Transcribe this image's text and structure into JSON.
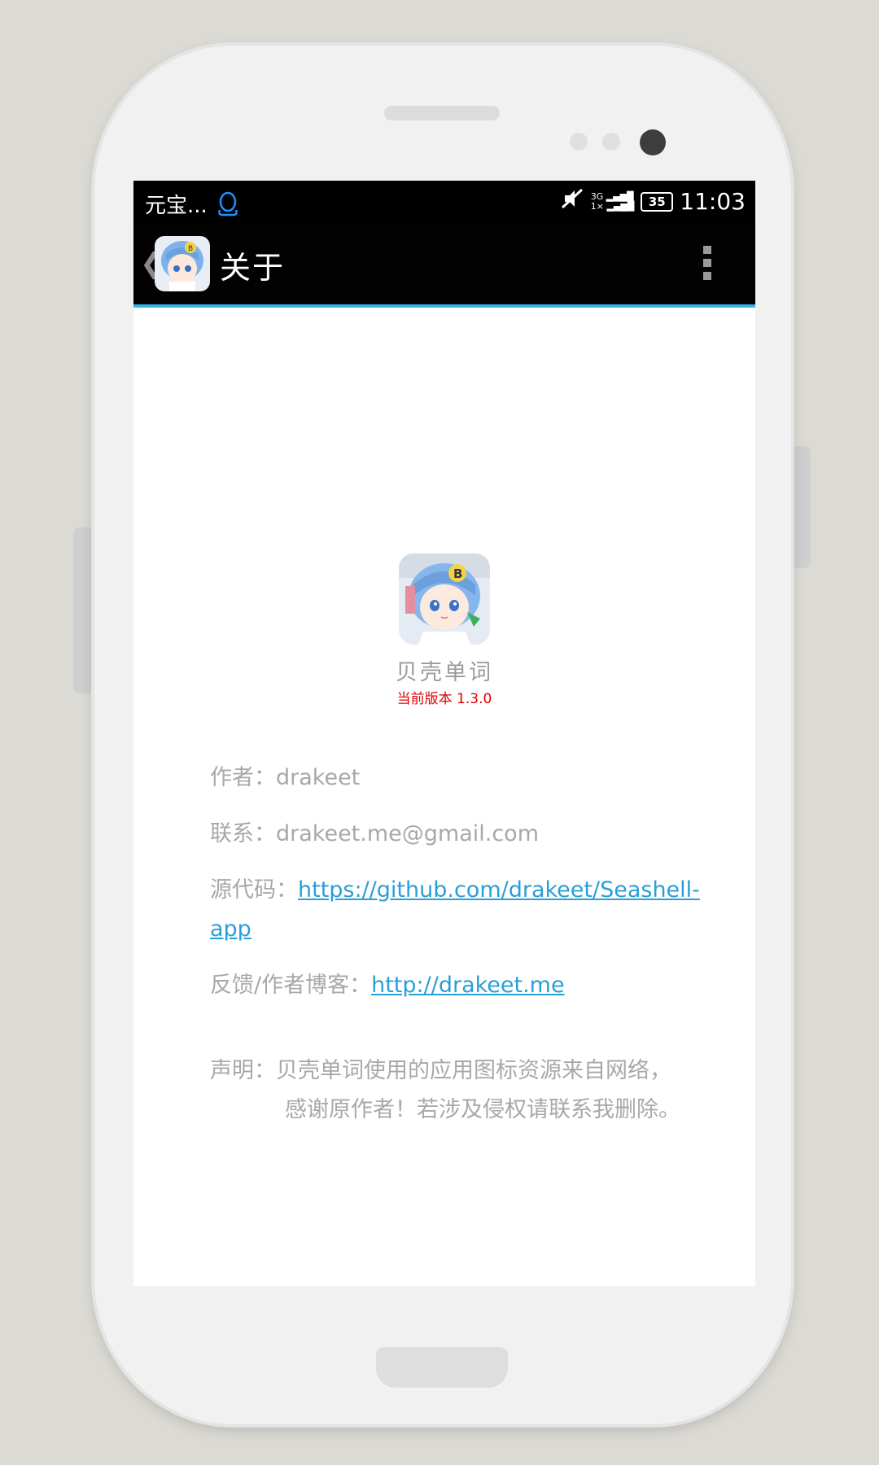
{
  "status_bar": {
    "carrier": "元宝...",
    "network_top": "3G",
    "network_bottom": "1×",
    "battery": "35",
    "time": "11:03"
  },
  "action_bar": {
    "title": "关于"
  },
  "about": {
    "app_name": "贝壳单词",
    "version": "当前版本 1.3.0",
    "author_label": "作者：",
    "author_value": "drakeet",
    "contact_label": "联系：",
    "contact_value": "drakeet.me@gmail.com",
    "source_label": "源代码：",
    "source_link": "https://github.com/drakeet/Seashell-app",
    "feedback_label": "反馈/作者博客：",
    "feedback_link": "http://drakeet.me",
    "notice_label": "声明：",
    "notice_line1": "贝壳单词使用的应用图标资源来自网络，",
    "notice_line2": "感谢原作者！若涉及侵权请联系我删除。"
  },
  "colors": {
    "accent": "#33b5e5",
    "link": "#2a9fd6",
    "version_red": "#e30000",
    "text_gray": "#a8a8a8"
  },
  "icons": [
    "qq-icon",
    "mute-icon",
    "signal-icon",
    "battery-icon",
    "back-chevron-icon",
    "app-icon",
    "overflow-menu-icon"
  ]
}
